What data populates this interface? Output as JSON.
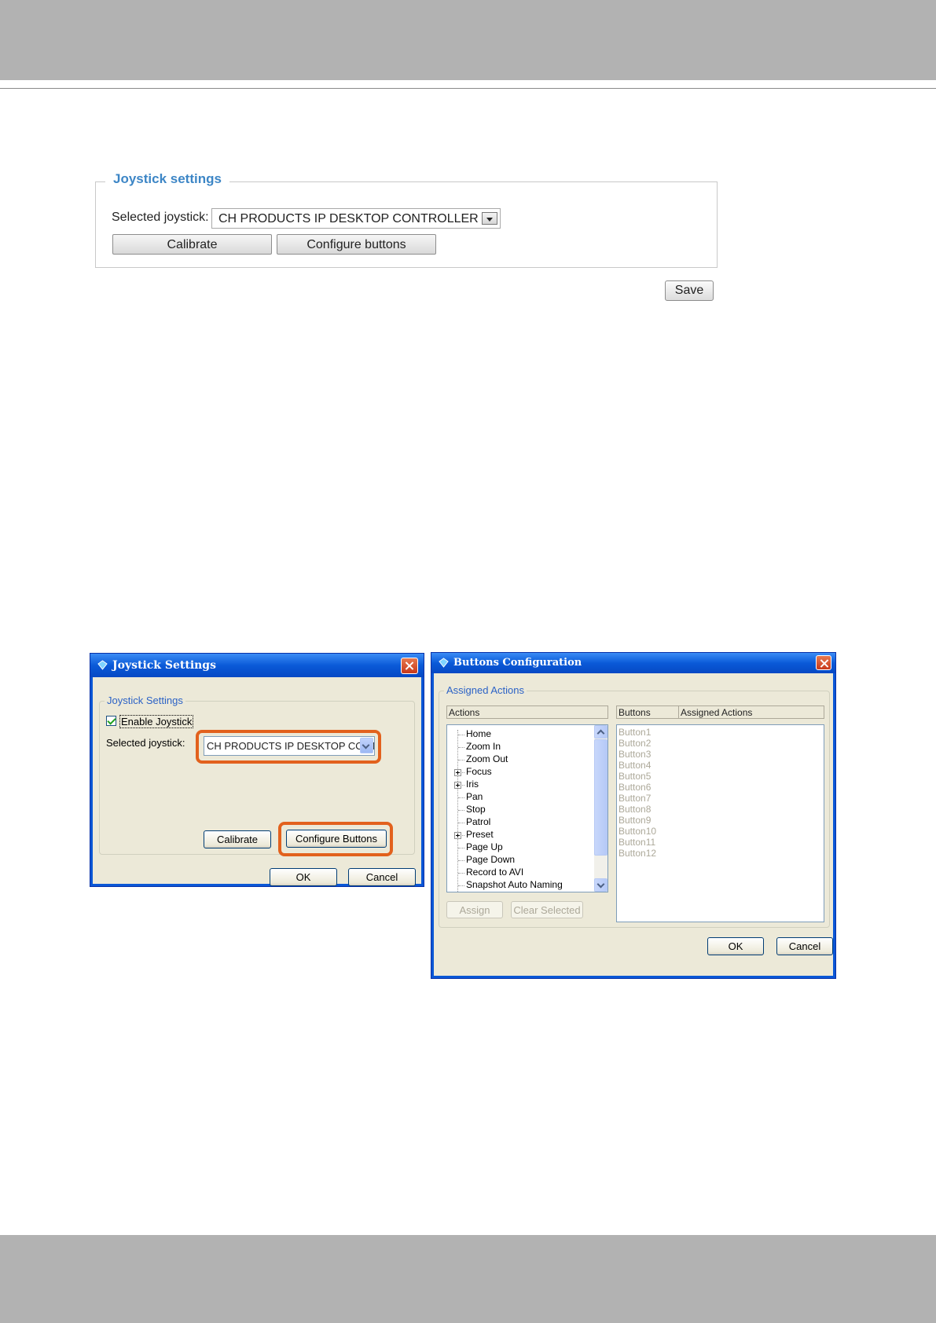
{
  "web_panel": {
    "legend": "Joystick settings",
    "selected_label": "Selected joystick:",
    "selected_value": "CH PRODUCTS IP DESKTOP CONTROLLER",
    "calibrate_label": "Calibrate",
    "configure_label": "Configure buttons",
    "save_label": "Save",
    "legend_color": "#3d86c6"
  },
  "joystick_dialog": {
    "title": "Joystick Settings",
    "group_legend": "Joystick Settings",
    "enable_label": "Enable Joystick",
    "enable_checked": true,
    "selected_label": "Selected joystick:",
    "selected_value": "CH PRODUCTS IP DESKTOP CONTROLLER",
    "calibrate_label": "Calibrate",
    "configure_label": "Configure Buttons",
    "ok_label": "OK",
    "cancel_label": "Cancel",
    "highlight_color": "#e2611d"
  },
  "buttons_dialog": {
    "title": "Buttons Configuration",
    "group_legend": "Assigned Actions",
    "actions_header": "Actions",
    "buttons_header": "Buttons",
    "assigned_header": "Assigned Actions",
    "actions": [
      {
        "label": "Home",
        "expandable": false
      },
      {
        "label": "Zoom In",
        "expandable": false
      },
      {
        "label": "Zoom Out",
        "expandable": false
      },
      {
        "label": "Focus",
        "expandable": true
      },
      {
        "label": "Iris",
        "expandable": true
      },
      {
        "label": "Pan",
        "expandable": false
      },
      {
        "label": "Stop",
        "expandable": false
      },
      {
        "label": "Patrol",
        "expandable": false
      },
      {
        "label": "Preset",
        "expandable": true
      },
      {
        "label": "Page Up",
        "expandable": false
      },
      {
        "label": "Page Down",
        "expandable": false
      },
      {
        "label": "Record to AVI",
        "expandable": false
      },
      {
        "label": "Snapshot Auto Naming",
        "expandable": false
      }
    ],
    "buttons": [
      "Button1",
      "Button2",
      "Button3",
      "Button4",
      "Button5",
      "Button6",
      "Button7",
      "Button8",
      "Button9",
      "Button10",
      "Button11",
      "Button12"
    ],
    "assign_label": "Assign",
    "clear_label": "Clear Selected",
    "ok_label": "OK",
    "cancel_label": "Cancel"
  }
}
